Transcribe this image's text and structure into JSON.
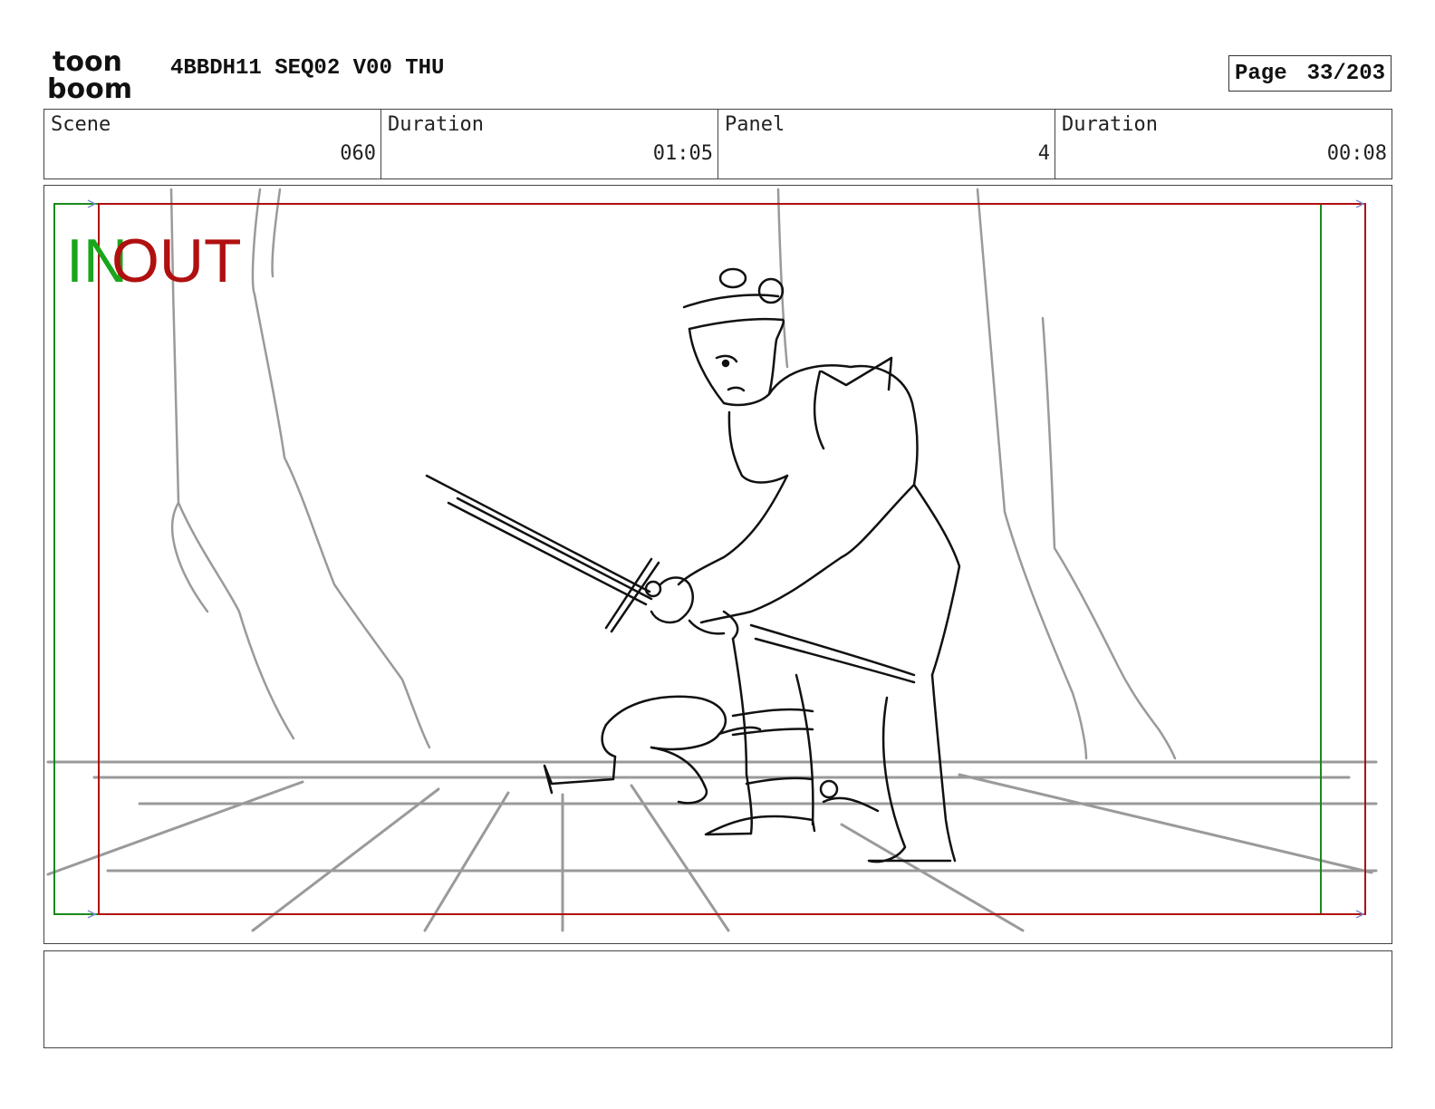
{
  "header": {
    "logo_text_top": "toon",
    "logo_text_bottom": "boom",
    "project_title": "4BBDH11 SEQ02 V00 THU",
    "page_label": "Page",
    "page_value": "33/203"
  },
  "info": {
    "scene_label": "Scene",
    "scene_value": "060",
    "scene_duration_label": "Duration",
    "scene_duration_value": "01:05",
    "panel_label": "Panel",
    "panel_value": "4",
    "panel_duration_label": "Duration",
    "panel_duration_value": "00:08"
  },
  "frame": {
    "in_label": "IN",
    "out_label": "OUT",
    "in_color": "#1aa61a",
    "out_color": "#b01010"
  },
  "notes": {
    "text": ""
  }
}
